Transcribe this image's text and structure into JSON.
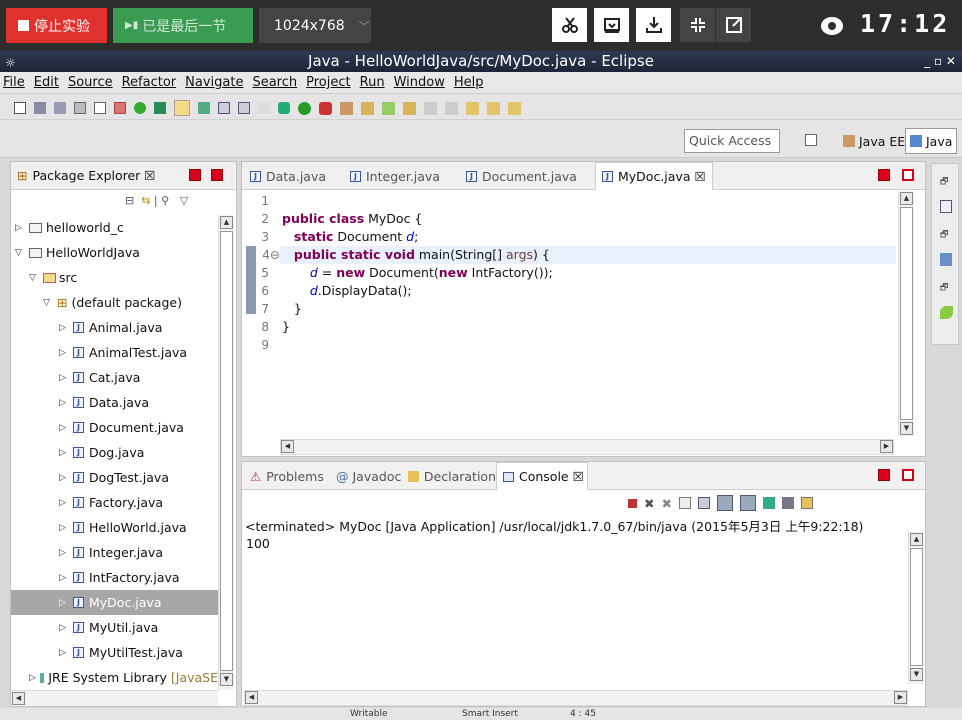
{
  "session": {
    "stop_label": "停止实验",
    "last_label": "已是最后一节",
    "resolution": "1024x768",
    "clock": "17:12"
  },
  "window": {
    "title": "Java - HelloWorldJava/src/MyDoc.java - Eclipse"
  },
  "menu": [
    "File",
    "Edit",
    "Source",
    "Refactor",
    "Navigate",
    "Search",
    "Project",
    "Run",
    "Window",
    "Help"
  ],
  "toolbar": {
    "quick_access": "Quick Access",
    "persp_javaee": "Java EE",
    "persp_java": "Java"
  },
  "explorer": {
    "title": "Package Explorer ☒",
    "items": [
      {
        "label": "helloworld_c"
      },
      {
        "label": "HelloWorldJava"
      },
      {
        "label": "src"
      },
      {
        "label": "(default package)"
      },
      {
        "label": "Animal.java"
      },
      {
        "label": "AnimalTest.java"
      },
      {
        "label": "Cat.java"
      },
      {
        "label": "Data.java"
      },
      {
        "label": "Document.java"
      },
      {
        "label": "Dog.java"
      },
      {
        "label": "DogTest.java"
      },
      {
        "label": "Factory.java"
      },
      {
        "label": "HelloWorld.java"
      },
      {
        "label": "Integer.java"
      },
      {
        "label": "IntFactory.java"
      },
      {
        "label": "MyDoc.java"
      },
      {
        "label": "MyUtil.java"
      },
      {
        "label": "MyUtilTest.java"
      },
      {
        "label": "JRE System Library",
        "extra": "[JavaSE"
      }
    ]
  },
  "editor": {
    "tabs": [
      {
        "label": "Data.java"
      },
      {
        "label": "Integer.java"
      },
      {
        "label": "Document.java"
      },
      {
        "label": "MyDoc.java ☒"
      }
    ],
    "line_numbers": [
      "1",
      "2",
      "3",
      "4⊖",
      "5",
      "6",
      "7",
      "8",
      "9"
    ]
  },
  "console": {
    "tabs": [
      {
        "label": "Problems"
      },
      {
        "label": "Javadoc"
      },
      {
        "label": "Declaration"
      },
      {
        "label": "Console ☒"
      }
    ],
    "status": "<terminated> MyDoc [Java Application] /usr/local/jdk1.7.0_67/bin/java (2015年5月3日 上午9:22:18)",
    "output": "100"
  },
  "statusbar": {
    "writable": "Writable",
    "insert": "Smart Insert",
    "position": "4 : 45"
  }
}
